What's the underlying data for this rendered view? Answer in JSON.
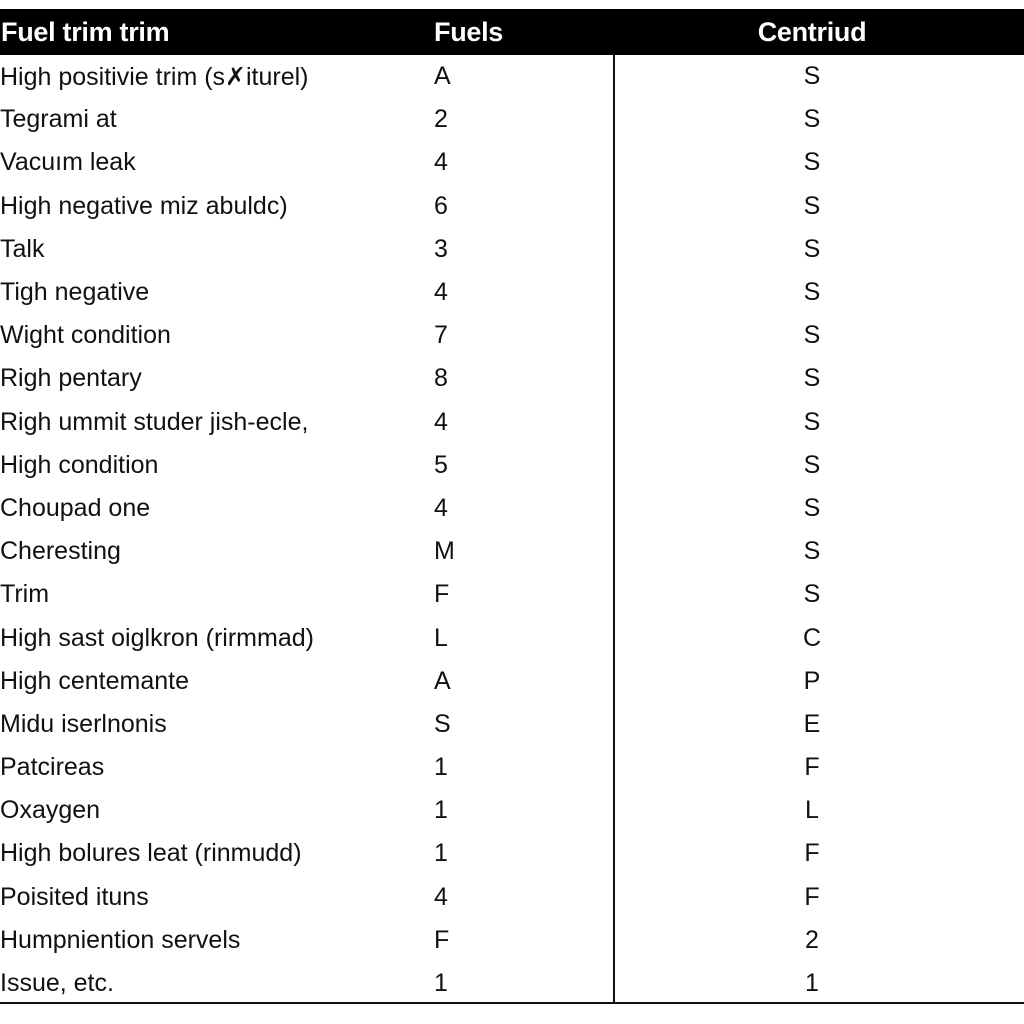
{
  "table": {
    "headers": [
      "Fuel trim trim",
      "Fuels",
      "Centriud"
    ],
    "rows": [
      [
        "High positivie trim (s✗iturel)",
        "A",
        "S"
      ],
      [
        "Tegrami at",
        "2",
        "S"
      ],
      [
        "Vacuım leak",
        "4",
        "S"
      ],
      [
        "High negative miz abuldc)",
        "6",
        "S"
      ],
      [
        "Talk",
        "3",
        "S"
      ],
      [
        "Tigh negative",
        "4",
        "S"
      ],
      [
        "Wight condition",
        "7",
        "S"
      ],
      [
        "Righ pentary",
        "8",
        "S"
      ],
      [
        "Righ ummit studer jish-ecle,",
        "4",
        "S"
      ],
      [
        "High condition",
        "5",
        "S"
      ],
      [
        "Choupad one",
        "4",
        "S"
      ],
      [
        "Cheresting",
        "M",
        "S"
      ],
      [
        "Trim",
        "F",
        "S"
      ],
      [
        "High sast oiglkron (rirmmad)",
        "L",
        "C"
      ],
      [
        "High centemante",
        "A",
        "P"
      ],
      [
        "Midu iserlnonis",
        "S",
        "E"
      ],
      [
        "Patcireas",
        "1",
        "F"
      ],
      [
        "Oxaygen",
        "1",
        "L"
      ],
      [
        "High bolures leat (rinmudd)",
        "1",
        "F"
      ],
      [
        "Poisited ituns",
        "4",
        "F"
      ],
      [
        "Humpniention servels",
        "F",
        "2"
      ],
      [
        "Issue, etc.",
        "1",
        "1"
      ]
    ]
  }
}
